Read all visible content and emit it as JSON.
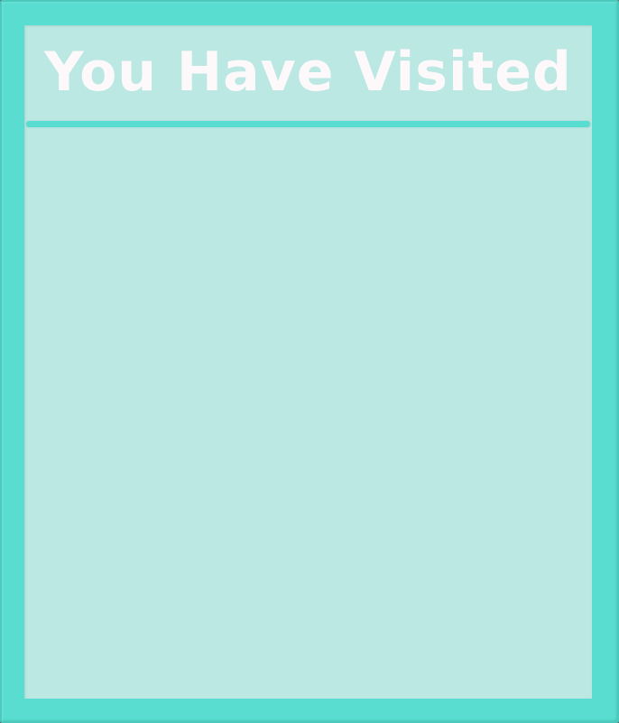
{
  "panel": {
    "title": "You Have Visited"
  },
  "colors": {
    "frame": "#58ddd0",
    "panel_background": "#bbe8e3",
    "title_text": "#fdf9fb"
  },
  "visited_items": []
}
